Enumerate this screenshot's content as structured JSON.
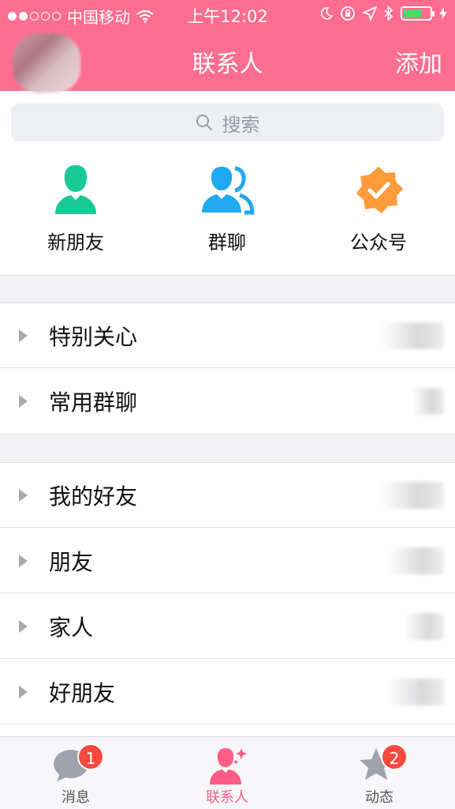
{
  "status_bar": {
    "carrier": "中国移动",
    "time": "上午12:02"
  },
  "header": {
    "title": "联系人",
    "add_label": "添加"
  },
  "search": {
    "placeholder": "搜索"
  },
  "quick_entries": [
    {
      "label": "新朋友",
      "icon": "new-friend-icon",
      "color": "#19c995"
    },
    {
      "label": "群聊",
      "icon": "group-chat-icon",
      "color": "#20a8f0"
    },
    {
      "label": "公众号",
      "icon": "official-account-icon",
      "color": "#ff9b3a"
    }
  ],
  "groups_top": [
    {
      "name": "特别关心"
    },
    {
      "name": "常用群聊"
    }
  ],
  "groups_main": [
    {
      "name": "我的好友"
    },
    {
      "name": "朋友"
    },
    {
      "name": "家人"
    },
    {
      "name": "好朋友"
    }
  ],
  "tabbar": {
    "tabs": [
      {
        "label": "消息",
        "icon": "message-icon",
        "badge": "1"
      },
      {
        "label": "联系人",
        "icon": "contacts-icon",
        "badge": ""
      },
      {
        "label": "动态",
        "icon": "star-icon",
        "badge": "2"
      }
    ],
    "active_color": "#ff5d86"
  },
  "colors": {
    "header_bg": "#ff6d8f",
    "badge": "#f74a3e"
  }
}
